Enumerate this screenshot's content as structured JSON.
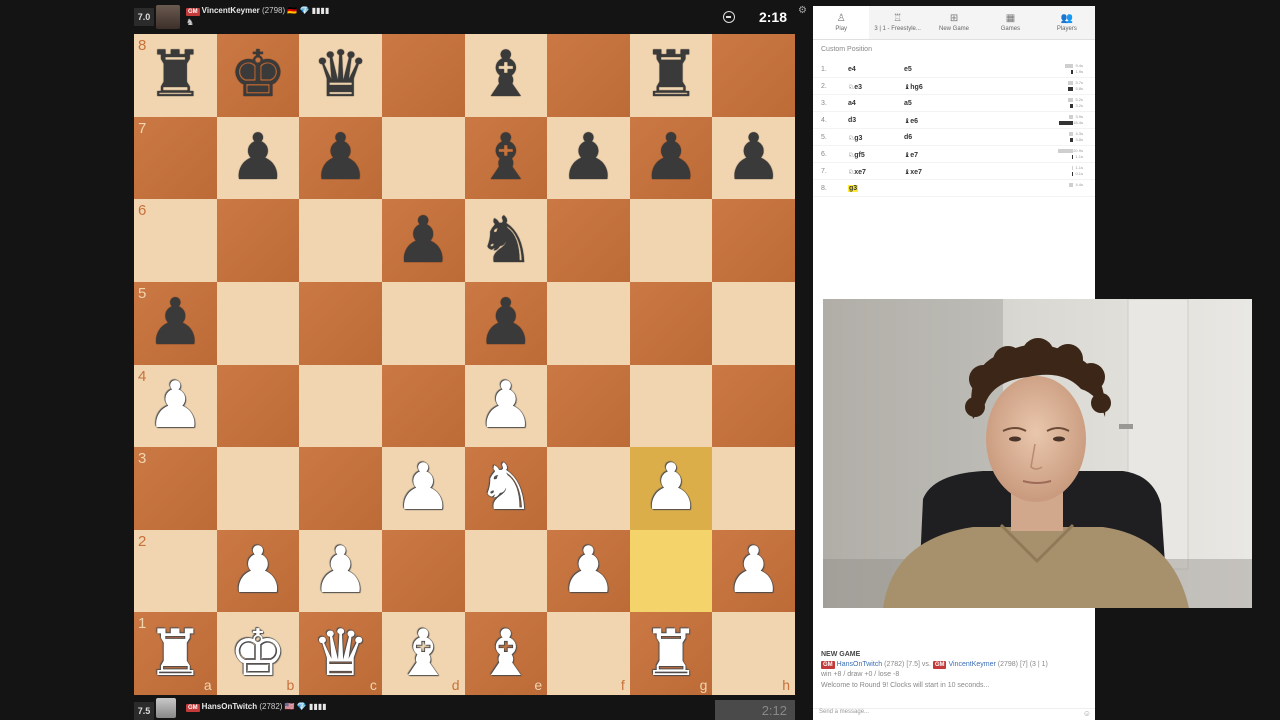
{
  "top_player": {
    "score": "7.0",
    "title": "GM",
    "name": "VincentKeymer",
    "rating": "(2798)",
    "flags": "🇩🇪 💎 ▮▮▮▮",
    "clock": "2:18",
    "icon": "knight-icon"
  },
  "bottom_player": {
    "score": "7.5",
    "title": "GM",
    "name": "HansOnTwitch",
    "rating": "(2782)",
    "flags": "🇺🇸 💎 ▮▮▮▮",
    "clock": "2:12"
  },
  "board": {
    "rank_labels": [
      "8",
      "7",
      "6",
      "5",
      "4",
      "3",
      "2",
      "1"
    ],
    "file_labels": [
      "a",
      "b",
      "c",
      "d",
      "e",
      "f",
      "g",
      "h"
    ],
    "rows": [
      [
        "br",
        "bk",
        "bq",
        "",
        "bb",
        "",
        "br",
        ""
      ],
      [
        "",
        "bp",
        "bp",
        "",
        "bb",
        "bp",
        "bp",
        "bp"
      ],
      [
        "",
        "",
        "",
        "bp",
        "bn",
        "",
        "",
        ""
      ],
      [
        "bp",
        "",
        "",
        "",
        "bp",
        "",
        "",
        ""
      ],
      [
        "wp",
        "",
        "",
        "",
        "wp",
        "",
        "",
        ""
      ],
      [
        "",
        "",
        "",
        "wp",
        "wn",
        "",
        "wp",
        ""
      ],
      [
        "",
        "wp",
        "wp",
        "",
        "",
        "wp",
        "",
        "wp"
      ],
      [
        "wr",
        "wk",
        "wq",
        "wb",
        "wb",
        "",
        "wr",
        ""
      ]
    ],
    "highlighted": [
      "g3",
      "g2"
    ]
  },
  "panel": {
    "tabs": [
      {
        "label": "Play",
        "icon": "play-icon"
      },
      {
        "label": "3 | 1 - Freestyle...",
        "icon": "trophy-icon"
      },
      {
        "label": "New Game",
        "icon": "plus-icon"
      },
      {
        "label": "Games",
        "icon": "board-icon"
      },
      {
        "label": "Players",
        "icon": "players-icon"
      }
    ],
    "custom_position": "Custom Position",
    "moves": [
      {
        "num": "1.",
        "white": "e4",
        "black": "e5",
        "t1": "9.4s",
        "t2": "1.9s",
        "w": 8,
        "b": 2
      },
      {
        "num": "2.",
        "white": "♘e3",
        "black": "♝hg6",
        "t1": "5.7s",
        "t2": "5.8s",
        "w": 5,
        "b": 5
      },
      {
        "num": "3.",
        "white": "a4",
        "black": "a5",
        "t1": "5.2s",
        "t2": "3.2s",
        "w": 5,
        "b": 3
      },
      {
        "num": "4.",
        "white": "d3",
        "black": "♝e6",
        "t1": "3.9s",
        "t2": "18.4s",
        "w": 4,
        "b": 14
      },
      {
        "num": "5.",
        "white": "♘g3",
        "black": "d6",
        "t1": "4.3s",
        "t2": "3.8s",
        "w": 4,
        "b": 3
      },
      {
        "num": "6.",
        "white": "♘gf5",
        "black": "♝e7",
        "t1": "20.9s",
        "t2": "1.1s",
        "w": 15,
        "b": 1
      },
      {
        "num": "7.",
        "white": "♘xe7",
        "black": "♝xe7",
        "t1": "1.1s",
        "t2": "0.1s",
        "w": 1,
        "b": 1
      },
      {
        "num": "8.",
        "white": "g3",
        "black": "",
        "t1": "4.4s",
        "t2": "",
        "w": 4,
        "b": 0
      }
    ],
    "chat": {
      "title": "NEW GAME",
      "line1_gm1": "GM",
      "line1_p1": "HansOnTwitch",
      "line1_r1": "(2782) [7.5] vs.",
      "line1_gm2": "GM",
      "line1_p2": "VincentKeymer",
      "line1_r2": "(2798) [7] (3 | 1)",
      "line2": "win +8 / draw +0 / lose -8",
      "line3": "Welcome to Round 9! Clocks will start in 10 seconds...",
      "input_placeholder": "Send a message..."
    }
  }
}
